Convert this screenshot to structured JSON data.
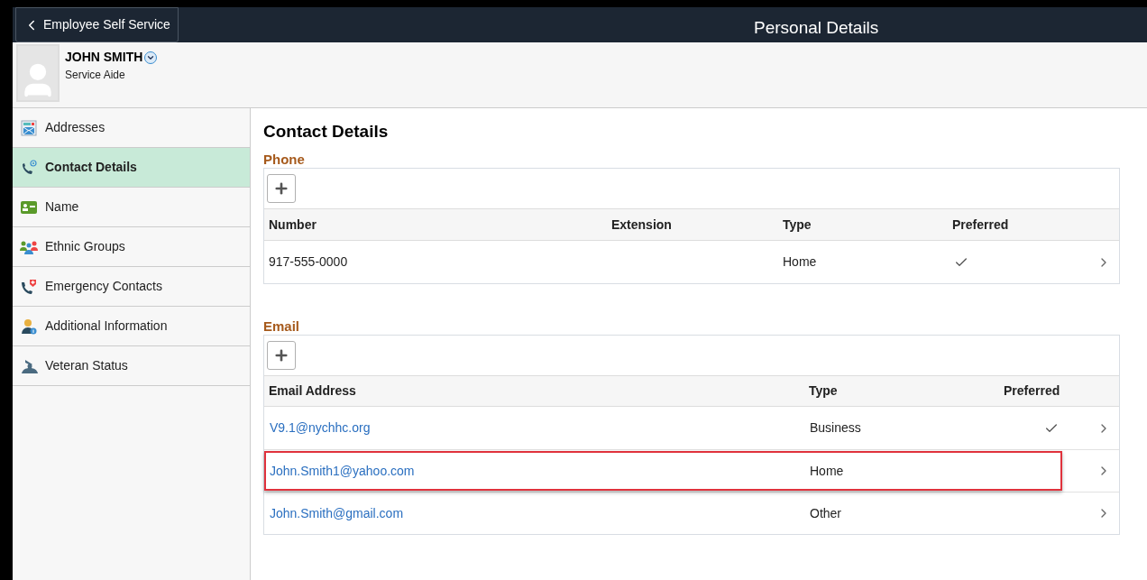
{
  "header": {
    "back_button": "Employee Self Service",
    "title": "Personal Details"
  },
  "profile": {
    "name": "JOHN SMITH",
    "job_title": "Service Aide"
  },
  "sidebar": {
    "items": [
      {
        "label": "Addresses",
        "kind": "addresses",
        "selected": false
      },
      {
        "label": "Contact Details",
        "kind": "contact",
        "selected": true
      },
      {
        "label": "Name",
        "kind": "name",
        "selected": false
      },
      {
        "label": "Ethnic Groups",
        "kind": "groups",
        "selected": false
      },
      {
        "label": "Emergency Contacts",
        "kind": "emergency",
        "selected": false
      },
      {
        "label": "Additional Information",
        "kind": "info",
        "selected": false
      },
      {
        "label": "Veteran Status",
        "kind": "veteran",
        "selected": false
      }
    ]
  },
  "page_title": "Contact Details",
  "phone": {
    "heading": "Phone",
    "columns": [
      "Number",
      "Extension",
      "Type",
      "Preferred"
    ],
    "rows": [
      {
        "number": "917-555-0000",
        "type": "Home",
        "preferred": true
      }
    ]
  },
  "email": {
    "heading": "Email",
    "columns": [
      "Email Address",
      "Type",
      "Preferred"
    ],
    "rows": [
      {
        "address": "V9.1@nychhc.org",
        "type": "Business",
        "preferred": true,
        "highlighted": false
      },
      {
        "address": "John.Smith1@yahoo.com",
        "type": "Home",
        "preferred": false,
        "highlighted": true
      },
      {
        "address": "John.Smith@gmail.com",
        "type": "Other",
        "preferred": false,
        "highlighted": false
      }
    ]
  }
}
